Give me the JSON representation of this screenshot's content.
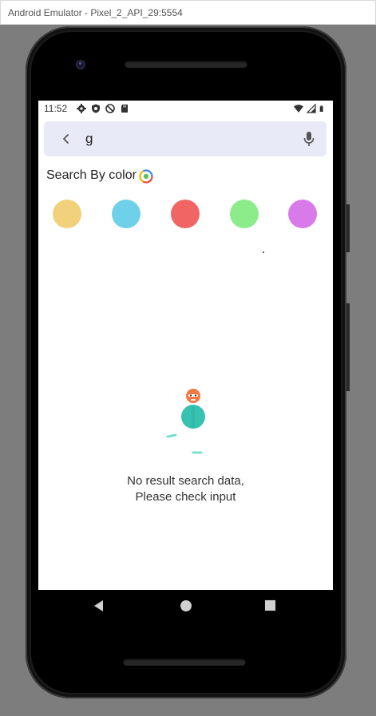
{
  "window": {
    "title": "Android Emulator - Pixel_2_API_29:5554"
  },
  "status_bar": {
    "time": "11:52",
    "left_icons": [
      "gear-icon",
      "shield-icon",
      "no-disturb-icon",
      "sd-card-icon"
    ],
    "right_icons": [
      "wifi-icon",
      "signal-icon",
      "battery-icon"
    ]
  },
  "search": {
    "query": "g",
    "back_icon": "chevron-left-icon",
    "mic_icon": "mic-icon"
  },
  "color_section": {
    "title": "Search By color",
    "icon": "color-palette-icon",
    "swatches": [
      {
        "name": "yellow",
        "color": "#f2d17d"
      },
      {
        "name": "blue",
        "color": "#6fd0ea"
      },
      {
        "name": "red",
        "color": "#f26565"
      },
      {
        "name": "green",
        "color": "#8cec8a"
      },
      {
        "name": "purple",
        "color": "#d97aeb"
      }
    ]
  },
  "empty_state": {
    "line1": "No result search data,",
    "line2": "Please check input",
    "illustration_icon": "person-illustration-icon"
  },
  "navbar": {
    "back": "nav-back-icon",
    "home": "nav-home-icon",
    "recents": "nav-recents-icon"
  },
  "colors": {
    "search_bg": "#e8ebf7",
    "screen_bg": "#ffffff",
    "accent_teal": "#35c2b0",
    "accent_orange": "#f07a45"
  }
}
